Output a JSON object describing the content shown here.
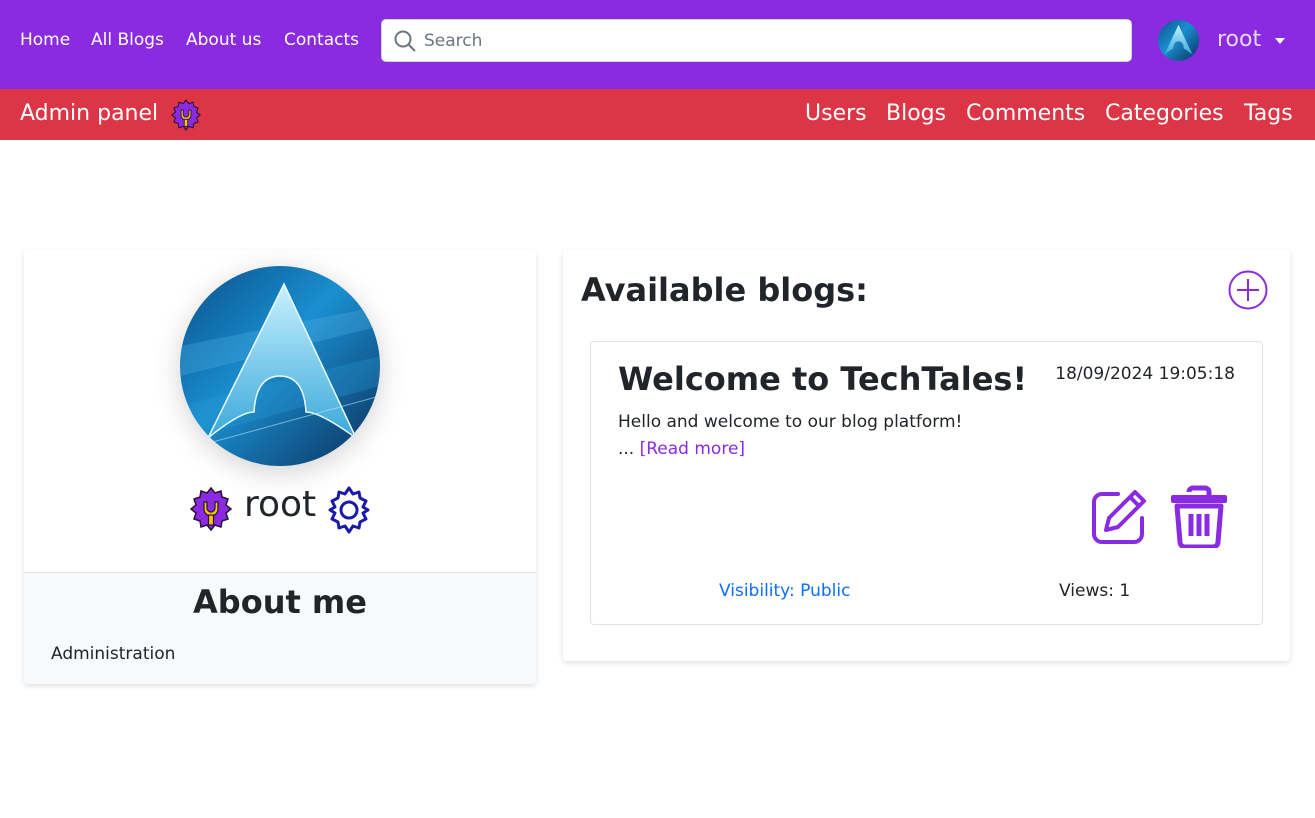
{
  "navbar": {
    "links": [
      {
        "label": "Home"
      },
      {
        "label": "All Blogs"
      },
      {
        "label": "About us"
      },
      {
        "label": "Contacts"
      }
    ],
    "search": {
      "placeholder": "Search",
      "value": ""
    },
    "user": {
      "name": "root",
      "avatar_icon": "arch-logo-avatar"
    }
  },
  "admin_bar": {
    "title": "Admin panel",
    "icon": "admin-gear-wrench-icon",
    "links": [
      {
        "label": "Users"
      },
      {
        "label": "Blogs"
      },
      {
        "label": "Comments"
      },
      {
        "label": "Categories"
      },
      {
        "label": "Tags"
      }
    ]
  },
  "profile": {
    "username": "root",
    "role_icon": "admin-gear-wrench-icon",
    "settings_icon": "settings-gear-icon",
    "about_title": "About me",
    "about_text": "Administration"
  },
  "blogs": {
    "title": "Available blogs:",
    "add_icon": "plus-circle-icon",
    "items": [
      {
        "title": "Welcome to TechTales!",
        "date": "18/09/2024 19:05:18",
        "excerpt_line1": "Hello and welcome to our blog platform!",
        "excerpt_prefix": "... ",
        "read_more": "[Read more]",
        "visibility": "Visibility: Public",
        "views": "Views: 1"
      }
    ]
  },
  "colors": {
    "primary": "#8a2be2",
    "admin_bar": "#dc3545",
    "link_blue": "#0d6efd",
    "badge_yellow": "#f5c518"
  }
}
